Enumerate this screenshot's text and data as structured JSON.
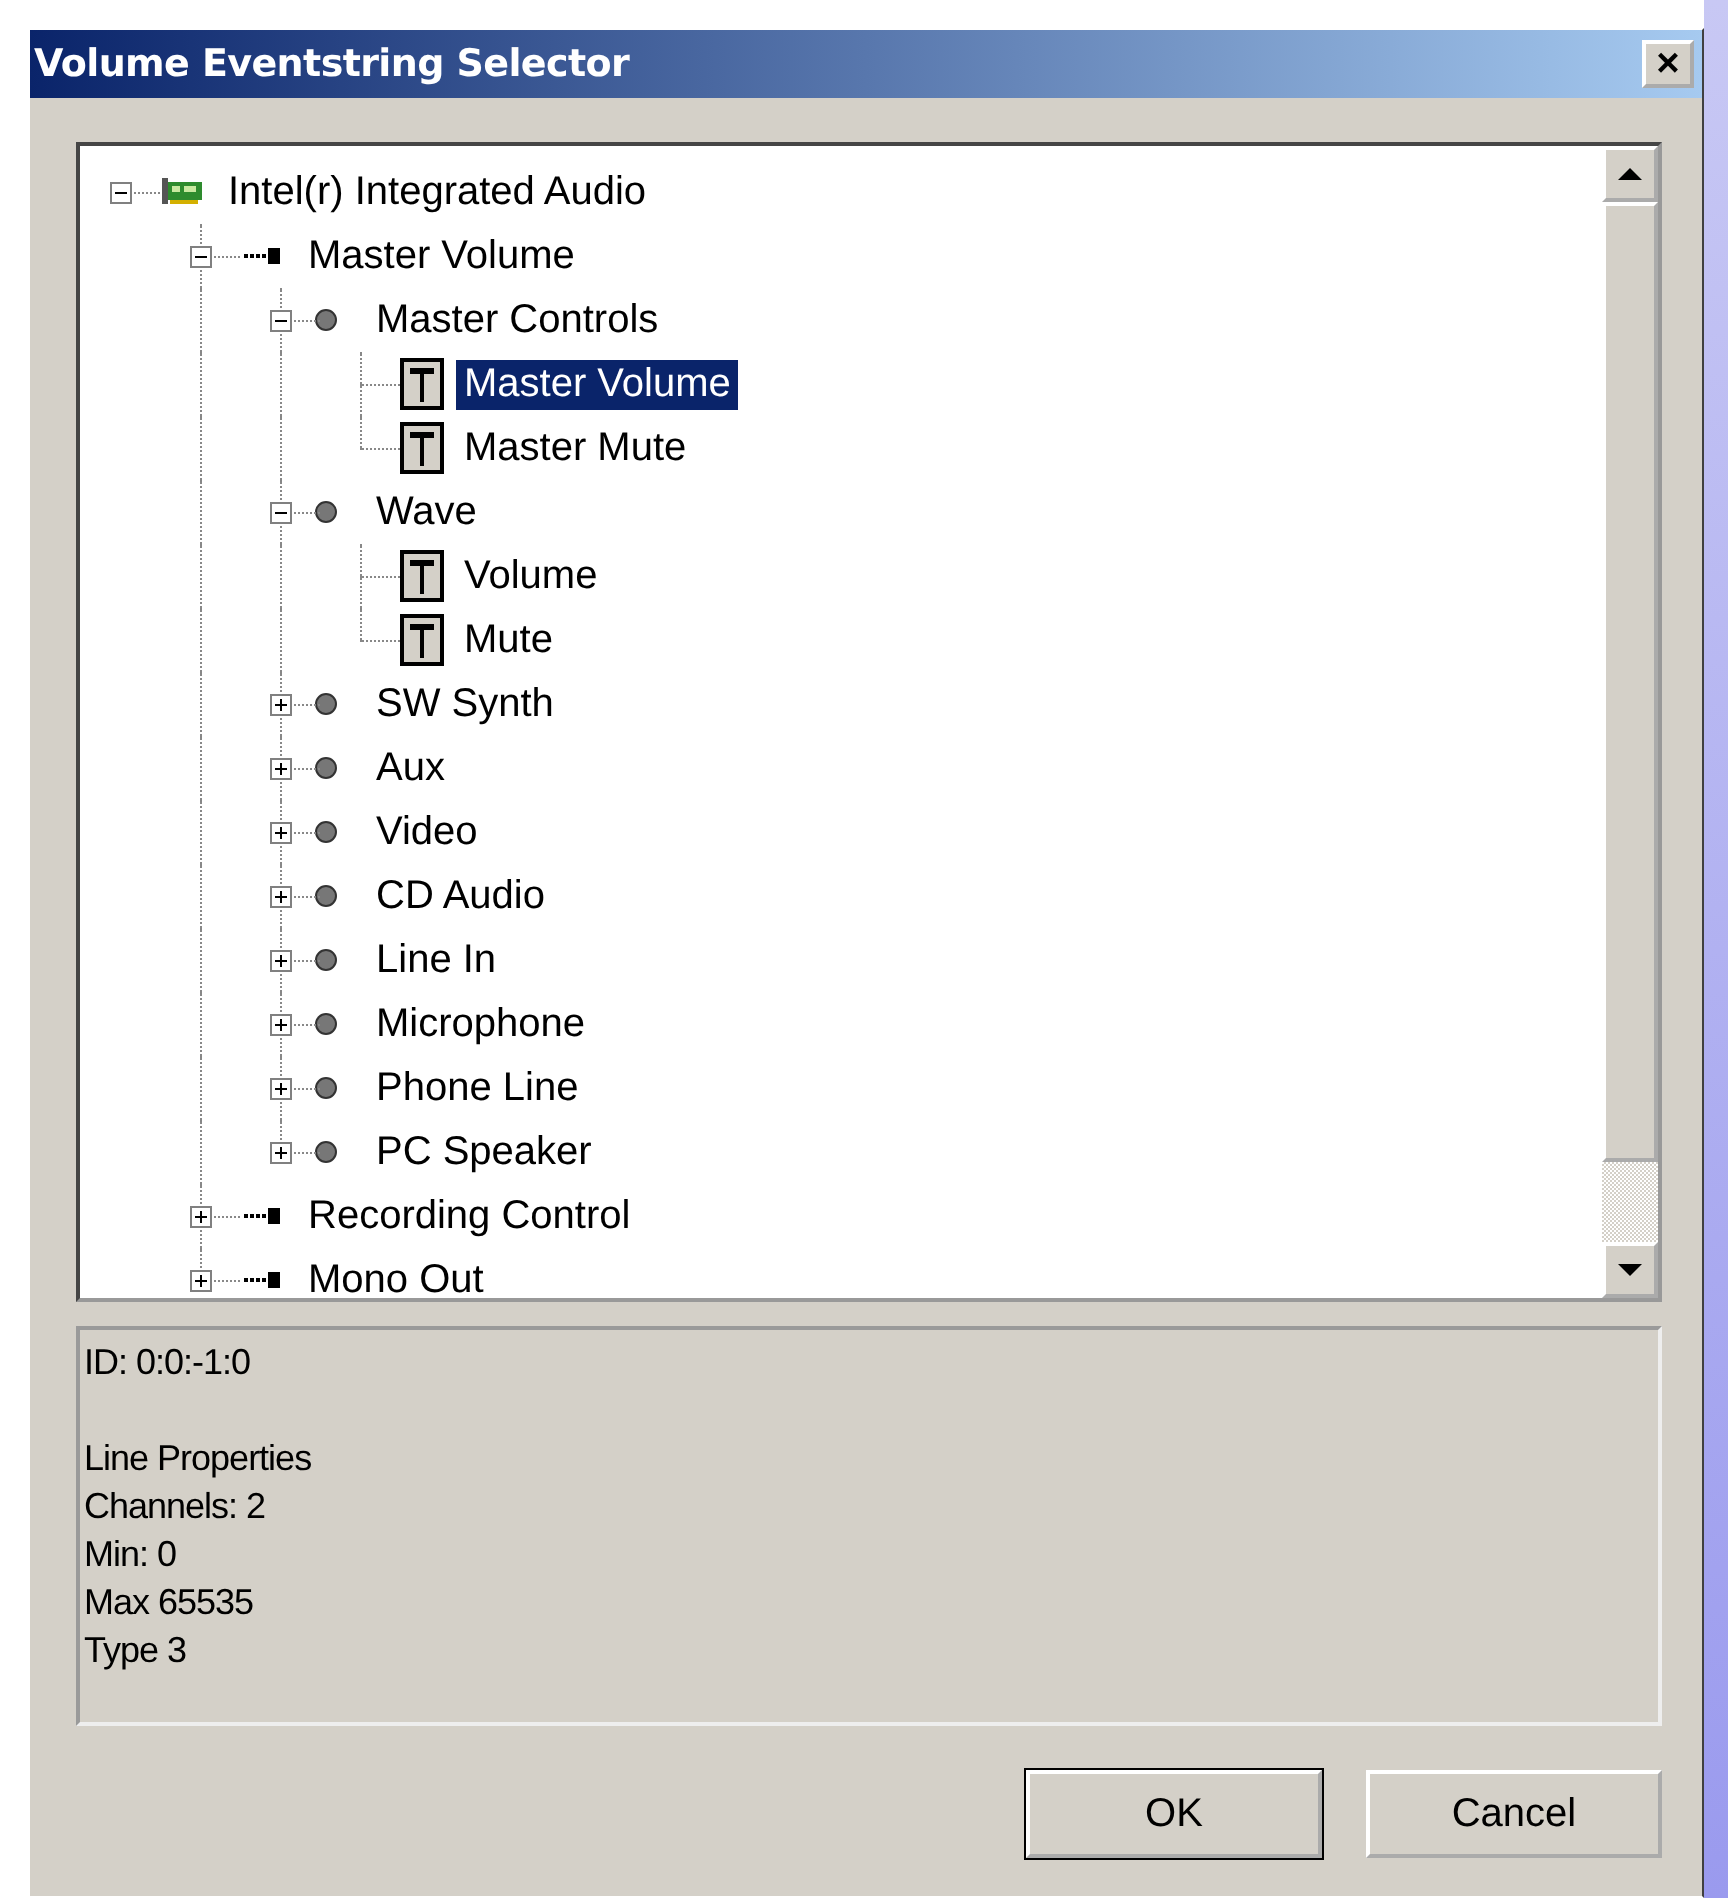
{
  "window": {
    "title": "Volume Eventstring Selector",
    "close": "×"
  },
  "tree": [
    {
      "label": "Intel(r) Integrated Audio",
      "kind": "device",
      "expanded": true,
      "selected": false,
      "children": [
        {
          "label": "Master Volume",
          "kind": "line",
          "expanded": true,
          "selected": false,
          "children": [
            {
              "label": "Master Controls",
              "kind": "control",
              "expanded": true,
              "selected": false,
              "children": [
                {
                  "label": "Master Volume",
                  "kind": "slider",
                  "selected": true
                },
                {
                  "label": "Master Mute",
                  "kind": "slider",
                  "selected": false
                }
              ]
            },
            {
              "label": "Wave",
              "kind": "control",
              "expanded": true,
              "selected": false,
              "children": [
                {
                  "label": "Volume",
                  "kind": "slider",
                  "selected": false
                },
                {
                  "label": "Mute",
                  "kind": "slider",
                  "selected": false
                }
              ]
            },
            {
              "label": "SW Synth",
              "kind": "control",
              "expanded": false,
              "selected": false
            },
            {
              "label": "Aux",
              "kind": "control",
              "expanded": false,
              "selected": false
            },
            {
              "label": "Video",
              "kind": "control",
              "expanded": false,
              "selected": false
            },
            {
              "label": "CD Audio",
              "kind": "control",
              "expanded": false,
              "selected": false
            },
            {
              "label": "Line In",
              "kind": "control",
              "expanded": false,
              "selected": false
            },
            {
              "label": "Microphone",
              "kind": "control",
              "expanded": false,
              "selected": false
            },
            {
              "label": "Phone Line",
              "kind": "control",
              "expanded": false,
              "selected": false
            },
            {
              "label": "PC Speaker",
              "kind": "control",
              "expanded": false,
              "selected": false
            }
          ]
        },
        {
          "label": "Recording Control",
          "kind": "line",
          "expanded": false,
          "selected": false
        },
        {
          "label": "Mono Out",
          "kind": "line",
          "expanded": false,
          "selected": false
        }
      ]
    }
  ],
  "info": {
    "id": "ID: 0:0:-1:0",
    "heading": "Line Properties",
    "lines": [
      "Channels: 2",
      "Min: 0",
      "Max 65535",
      "Type 3"
    ]
  },
  "buttons": [
    {
      "label": "OK",
      "default": true
    },
    {
      "label": "Cancel",
      "default": false
    }
  ]
}
